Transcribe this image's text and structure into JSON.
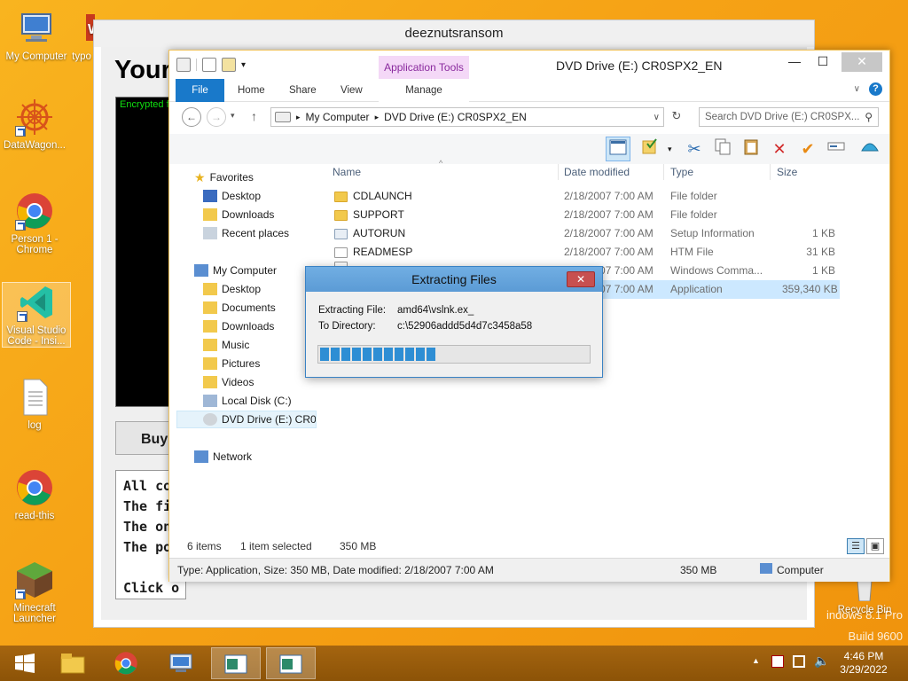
{
  "desktop": {
    "icons": [
      {
        "label": "My Computer"
      },
      {
        "label": "typo"
      },
      {
        "label": "DataWagon..."
      },
      {
        "label": "Person 1 - Chrome"
      },
      {
        "label": "Visual Studio Code - Insi..."
      },
      {
        "label": "log"
      },
      {
        "label": "read-this"
      },
      {
        "label": "Minecraft Launcher"
      },
      {
        "label": "Recycle Bin"
      }
    ],
    "watermark_line1": "indows 8.1 Pro",
    "watermark_line2": "Build 9600"
  },
  "ransom_window": {
    "title": "deeznutsransom",
    "heading": "Your",
    "console_text": "Encrypted fil",
    "buy_label": "Buy",
    "lines": [
      "All com",
      "The fil",
      "The on",
      "The po",
      "",
      "Click o"
    ]
  },
  "explorer": {
    "title": "DVD Drive (E:) CR0SPX2_EN",
    "app_tools_label": "Application Tools",
    "tabs": {
      "file": "File",
      "home": "Home",
      "share": "Share",
      "view": "View",
      "manage": "Manage"
    },
    "breadcrumb": [
      "My Computer",
      "DVD Drive (E:) CR0SPX2_EN"
    ],
    "search_placeholder": "Search DVD Drive (E:) CR0SPX...",
    "nav": {
      "favorites": "Favorites",
      "desktop": "Desktop",
      "downloads": "Downloads",
      "recent_places": "Recent places",
      "my_computer": "My Computer",
      "pc_desktop": "Desktop",
      "documents": "Documents",
      "pc_downloads": "Downloads",
      "music": "Music",
      "pictures": "Pictures",
      "videos": "Videos",
      "local_disk": "Local Disk (C:)",
      "dvd_drive": "DVD Drive (E:) CR0SPX2_EN",
      "network": "Network"
    },
    "columns": {
      "name": "Name",
      "date": "Date modified",
      "type": "Type",
      "size": "Size"
    },
    "files": [
      {
        "name": "CDLAUNCH",
        "date": "2/18/2007 7:00 AM",
        "type": "File folder",
        "size": ""
      },
      {
        "name": "SUPPORT",
        "date": "2/18/2007 7:00 AM",
        "type": "File folder",
        "size": ""
      },
      {
        "name": "AUTORUN",
        "date": "2/18/2007 7:00 AM",
        "type": "Setup Information",
        "size": "1 KB"
      },
      {
        "name": "READMESP",
        "date": "2/18/2007 7:00 AM",
        "type": "HTM File",
        "size": "31 KB"
      },
      {
        "name": "",
        "date": "2/18/2007 7:00 AM",
        "type": "Windows Comma...",
        "size": "1 KB"
      },
      {
        "name": "",
        "date": "2/18/2007 7:00 AM",
        "type": "Application",
        "size": "359,340 KB"
      }
    ],
    "status": {
      "items": "6 items",
      "selected": "1 item selected",
      "size": "350 MB"
    },
    "details": {
      "description": "Type: Application, Size: 350 MB, Date modified: 2/18/2007 7:00 AM",
      "size": "350 MB",
      "location": "Computer"
    }
  },
  "dialog": {
    "title": "Extracting Files",
    "file_label": "Extracting File:",
    "file_value": "amd64\\vslnk.ex_",
    "dir_label": "To Directory:",
    "dir_value": "c:\\52906addd5d4d7c3458a58",
    "progress_blocks": 11,
    "progress_fraction": 0.43
  },
  "taskbar": {
    "time": "4:46 PM",
    "date": "3/29/2022"
  }
}
